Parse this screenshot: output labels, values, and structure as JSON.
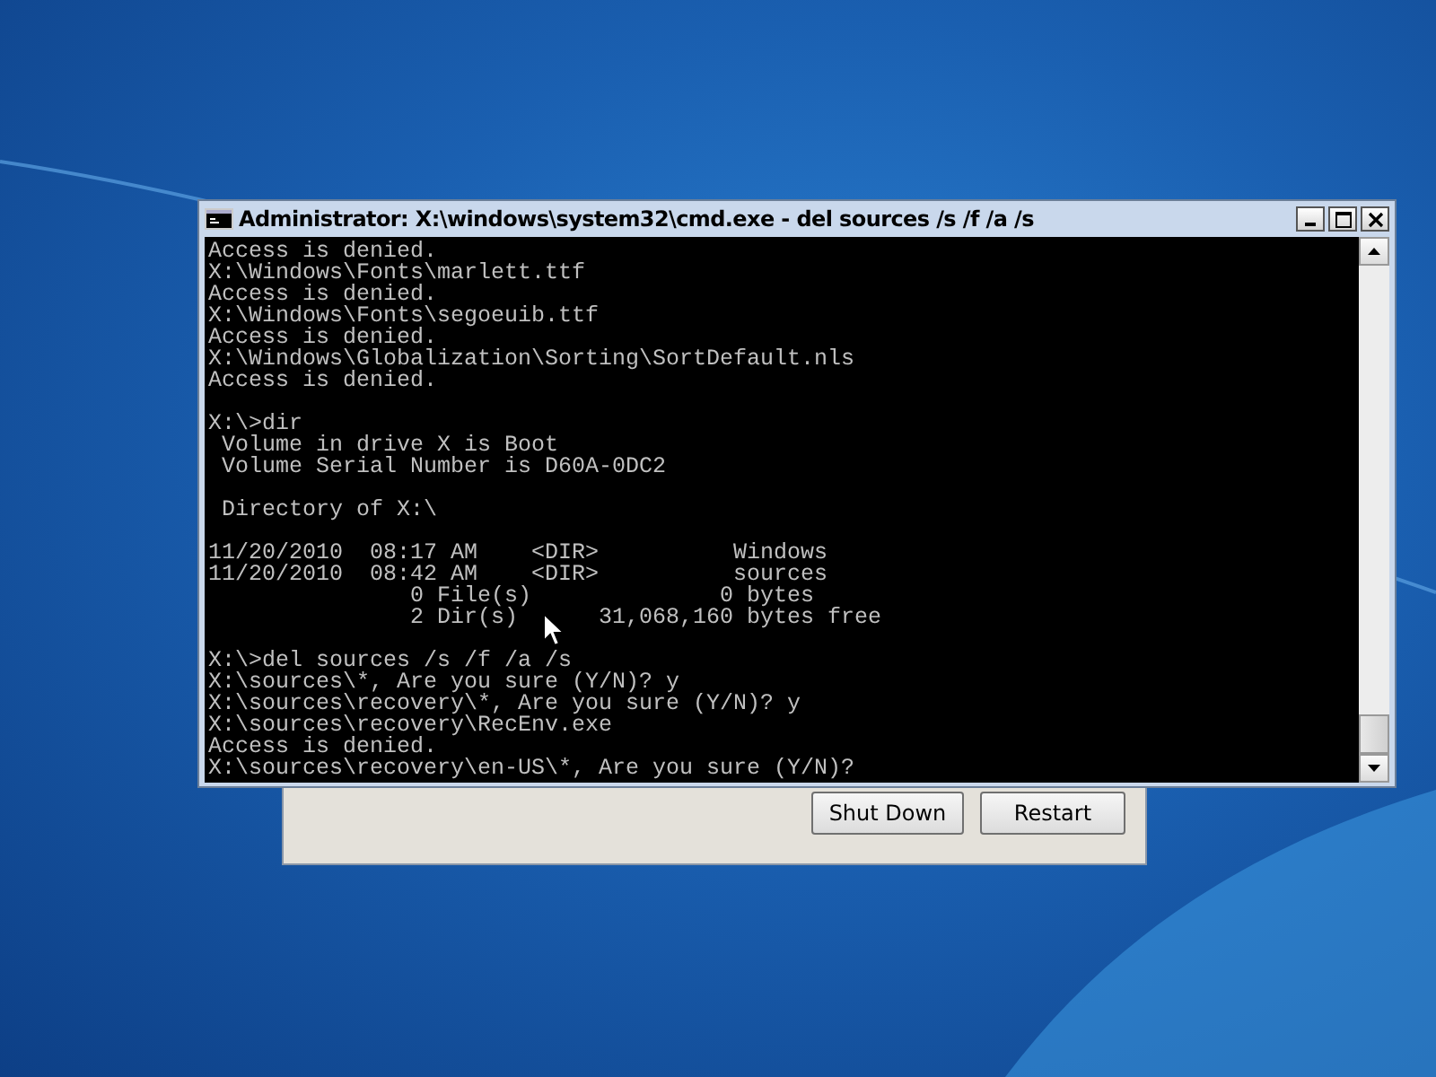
{
  "console_window": {
    "title": "Administrator: X:\\windows\\system32\\cmd.exe - del  sources /s /f /a /s",
    "blocks": [
      [
        "Access is denied.",
        "X:\\Windows\\Fonts\\marlett.ttf",
        "Access is denied.",
        "X:\\Windows\\Fonts\\segoeuib.ttf",
        "Access is denied.",
        "X:\\Windows\\Globalization\\Sorting\\SortDefault.nls",
        "Access is denied."
      ],
      [
        "X:\\>dir",
        " Volume in drive X is Boot",
        " Volume Serial Number is D60A-0DC2"
      ],
      [
        " Directory of X:\\"
      ],
      [
        "11/20/2010  08:17 AM    <DIR>          Windows",
        "11/20/2010  08:42 AM    <DIR>          sources",
        "               0 File(s)              0 bytes",
        "               2 Dir(s)      31,068,160 bytes free"
      ],
      [
        "X:\\>del sources /s /f /a /s",
        "X:\\sources\\*, Are you sure (Y/N)? y",
        "X:\\sources\\recovery\\*, Are you sure (Y/N)? y",
        "X:\\sources\\recovery\\RecEnv.exe",
        "Access is denied.",
        "X:\\sources\\recovery\\en-US\\*, Are you sure (Y/N)?"
      ]
    ]
  },
  "background_dialog": {
    "buttons": [
      {
        "label": "Shut Down"
      },
      {
        "label": "Restart"
      }
    ]
  }
}
